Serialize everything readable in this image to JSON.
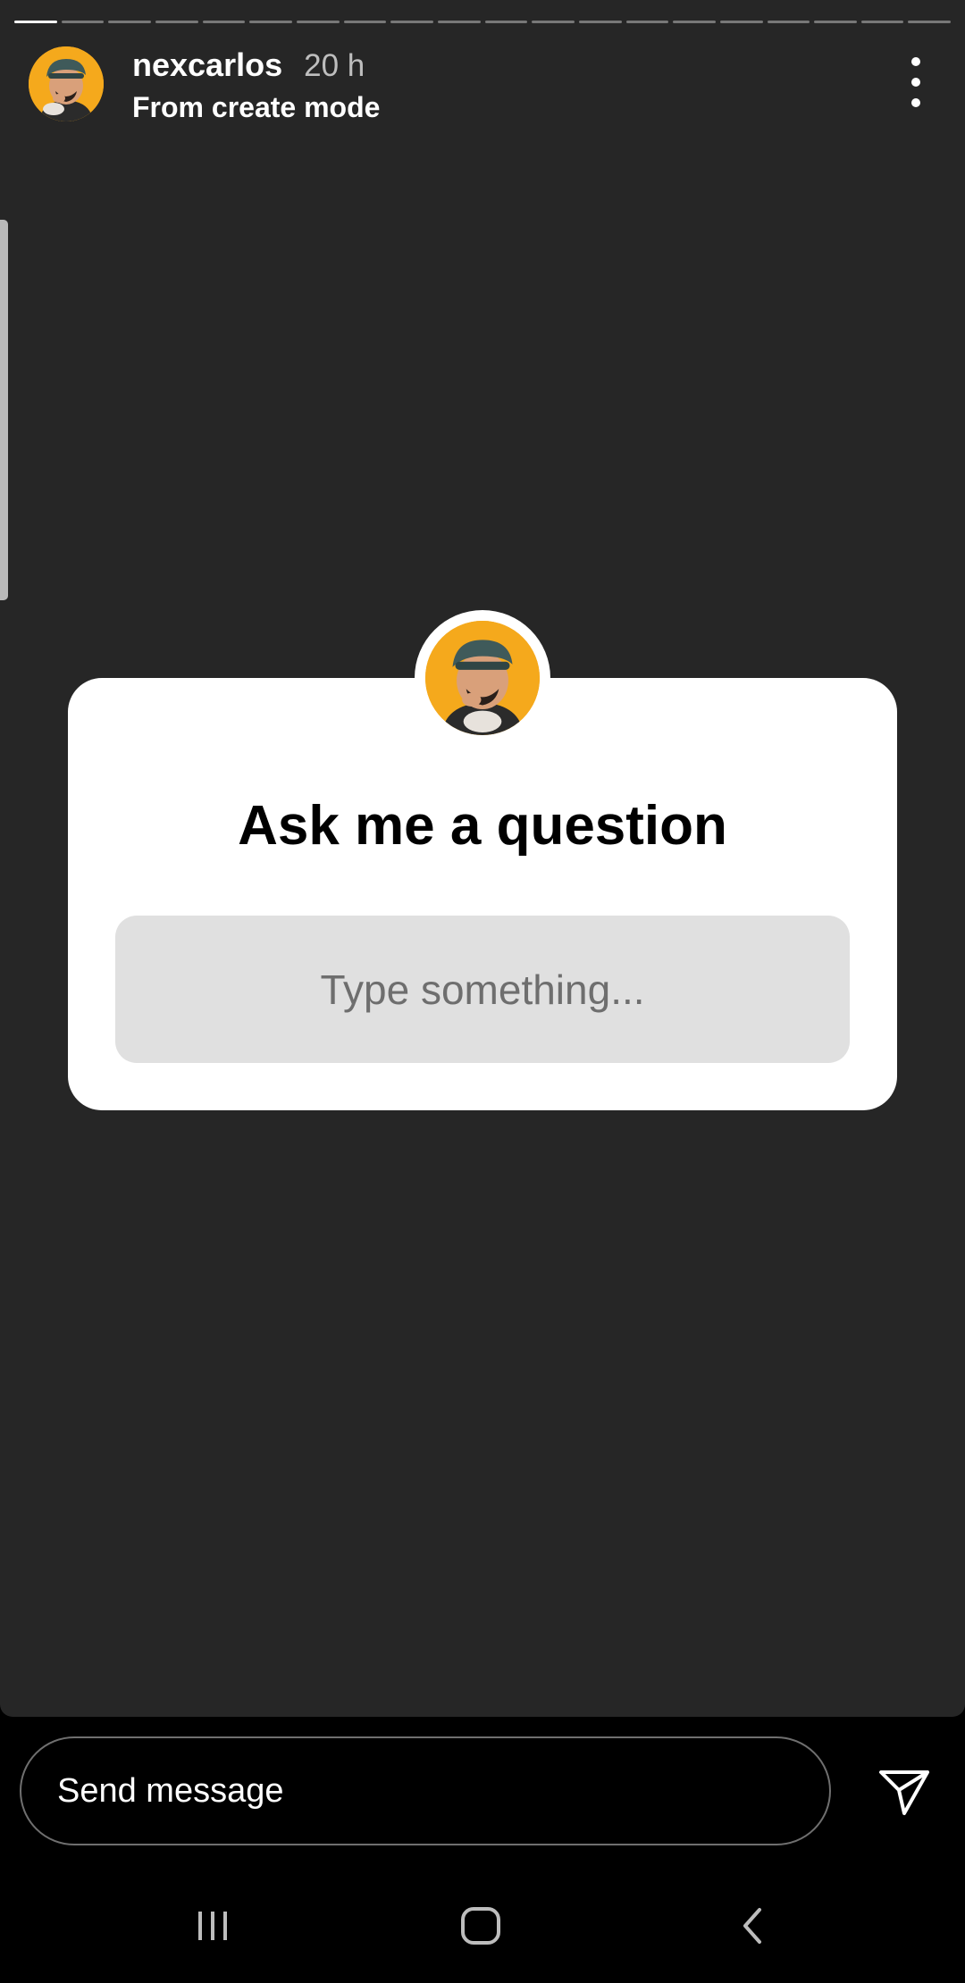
{
  "story": {
    "progress_segments": 20,
    "progress_completed": 1,
    "username": "nexcarlos",
    "time_ago": "20 h",
    "subtitle": "From create mode",
    "more_icon": "more-vertical-icon"
  },
  "sticker": {
    "title": "Ask me a question",
    "placeholder": "Type something..."
  },
  "reply_bar": {
    "placeholder": "Send message",
    "send_icon": "send-icon"
  },
  "system_nav": {
    "recents_icon": "recents-icon",
    "home_icon": "home-icon",
    "back_icon": "back-icon"
  },
  "colors": {
    "story_background": "#262626",
    "page_background": "#000000",
    "sticker_background": "#ffffff",
    "answer_box": "#e0e0e0",
    "avatar_background": "#f5a91c"
  }
}
